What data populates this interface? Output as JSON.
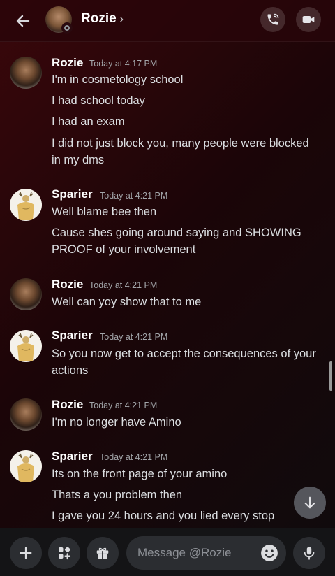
{
  "header": {
    "contact_name": "Rozie",
    "chevron": "›"
  },
  "messages": [
    {
      "author": "Rozie",
      "avatar": "rozie-avatar",
      "time": "Today at 4:17 PM",
      "lines": [
        "I'm in cosmetology school",
        "I had school today",
        "I had an exam",
        "I did not just block you, many people were blocked in my dms"
      ]
    },
    {
      "author": "Sparier",
      "avatar": "sparier-avatar",
      "time": "Today at 4:21 PM",
      "lines": [
        "Well blame bee then",
        "Cause shes going around saying and SHOWING PROOF of your involvement"
      ]
    },
    {
      "author": "Rozie",
      "avatar": "rozie-avatar",
      "time": "Today at 4:21 PM",
      "lines": [
        "Well can yoy show that to me"
      ]
    },
    {
      "author": "Sparier",
      "avatar": "sparier-avatar",
      "time": "Today at 4:21 PM",
      "lines": [
        "So you now get to accept the consequences of your actions"
      ]
    },
    {
      "author": "Rozie",
      "avatar": "rozie-avatar",
      "time": "Today at 4:21 PM",
      "lines": [
        "I'm no longer have Amino"
      ]
    },
    {
      "author": "Sparier",
      "avatar": "sparier-avatar",
      "time": "Today at 4:21 PM",
      "lines": [
        "Its on the front page of your amino",
        "Thats a you problem then",
        "I gave you 24 hours and you lied every stop"
      ]
    }
  ],
  "composer": {
    "placeholder": "Message @Rozie"
  },
  "icons": {
    "back": "arrow-left-icon",
    "call": "phone-icon",
    "video": "video-camera-icon",
    "plus": "plus-icon",
    "apps": "apps-icon",
    "gift": "gift-icon",
    "emoji": "emoji-icon",
    "mic": "microphone-icon",
    "jump": "arrow-down-icon"
  },
  "colors": {
    "background": "#1b0508",
    "accent_bg": "#3a070b",
    "text": "#dbdee1",
    "muted": "#a3a6aa"
  }
}
